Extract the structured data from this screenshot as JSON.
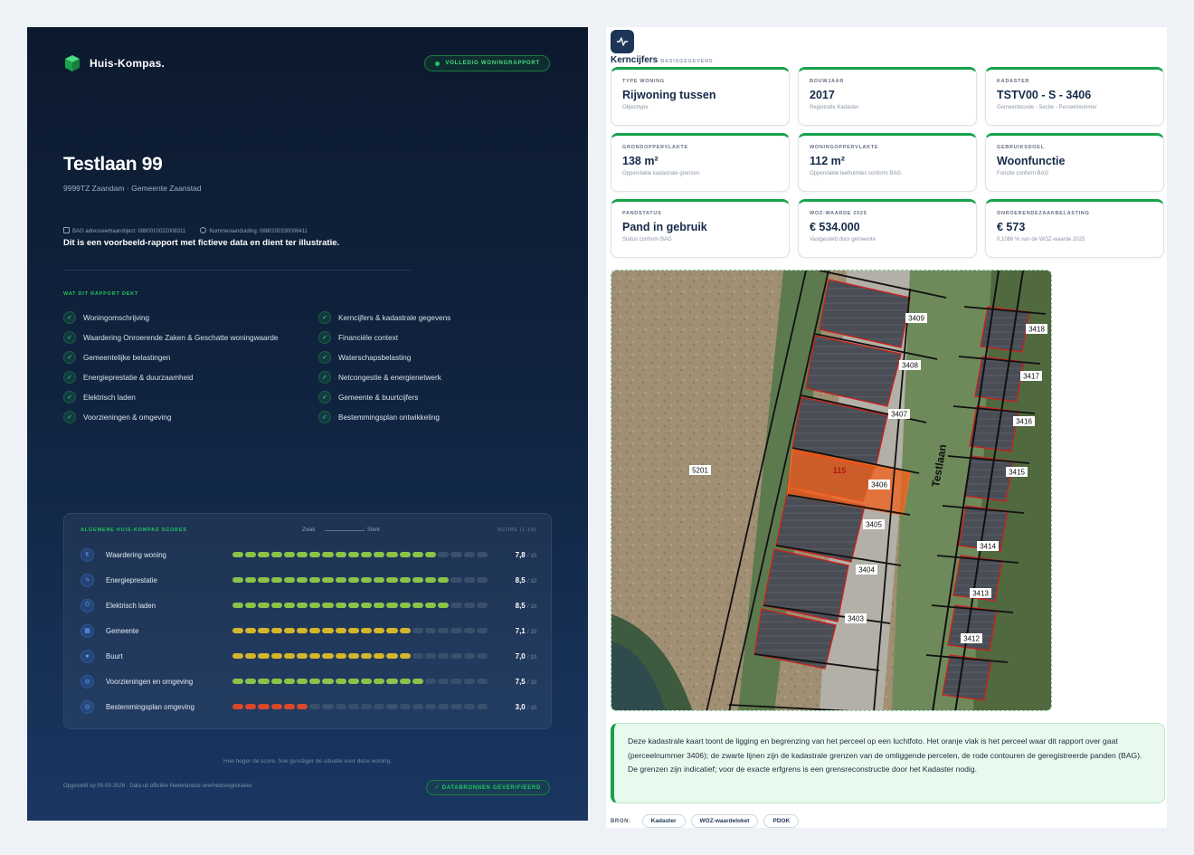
{
  "cover": {
    "brand": "Huis-Kompas.",
    "badge": "VOLLEDIG WONINGRAPPORT",
    "address": "Testlaan 99",
    "location": "9999TZ Zaandam · Gemeente Zaanstad",
    "bag_id": "BAG adresseerbaarobject: 0880010022008311",
    "num_id": "Nummeraanduiding: 0880200330006411",
    "disclaimer": "Dit is een voorbeeld-rapport met fictieve data en dient ter illustratie.",
    "covers_title": "WAT DIT RAPPORT DEKT",
    "covers_left": [
      "Woningomschrijving",
      "Waardering Onroerende Zaken & Geschatte woningwaarde",
      "Gemeentelijke belastingen",
      "Energieprestatie & duurzaamheid",
      "Elektrisch laden",
      "Voorzieningen & omgeving"
    ],
    "covers_right": [
      "Kerncijfers & kadastrale gegevens",
      "Financiële context",
      "Waterschapsbelasting",
      "Netcongestie & energienetwerk",
      "Gemeente & buurtcijfers",
      "Bestemmingsplan ontwikkeling"
    ],
    "scores_title": "ALGEMENE HUIS-KOMPAS SCORES",
    "weak": "Zwak",
    "strong": "Sterk",
    "score_label": "SCORE (1-10)",
    "out_of": "/ 10",
    "scores": [
      {
        "label": "Waardering woning",
        "value": "7,8",
        "score": 7.8,
        "color": "#8bc34a",
        "icon": "euro-icon"
      },
      {
        "label": "Energieprestatie",
        "value": "8,5",
        "score": 8.5,
        "color": "#8bc34a",
        "icon": "bolt-icon"
      },
      {
        "label": "Elektrisch laden",
        "value": "8,5",
        "score": 8.5,
        "color": "#8bc34a",
        "icon": "plug-icon"
      },
      {
        "label": "Gemeente",
        "value": "7,1",
        "score": 7.1,
        "color": "#d4b62c",
        "icon": "building-icon"
      },
      {
        "label": "Buurt",
        "value": "7,0",
        "score": 7.0,
        "color": "#d4b62c",
        "icon": "pin-icon"
      },
      {
        "label": "Voorzieningen en omgeving",
        "value": "7,5",
        "score": 7.5,
        "color": "#8bc34a",
        "icon": "compass-icon"
      },
      {
        "label": "Bestemmingsplan omgeving",
        "value": "3,0",
        "score": 3.0,
        "color": "#d9482b",
        "icon": "compass-icon"
      }
    ],
    "hint": "Hoe hoger de score, hoe gunstiger de situatie voor deze woning.",
    "footer": "Opgesteld op 05-05-2026 · Data uit officiële Nederlandse overheidsregistraties",
    "footer_badge": "✓  DATABRONNEN GEVERIFIEERD"
  },
  "kern": {
    "title": "Kerncijfers",
    "subtitle": "BASISGEGEVENS",
    "cards": [
      {
        "label": "TYPE WONING",
        "value": "Rijwoning tussen",
        "sub": "Objecttype"
      },
      {
        "label": "BOUWJAAR",
        "value": "2017",
        "sub": "Registratie Kadaster"
      },
      {
        "label": "KADASTER",
        "value": "TSTV00 - S - 3406",
        "sub": "Gemeentecode - Sectie - Perceelnummer"
      },
      {
        "label": "GRONDOPPERVLAKTE",
        "value": "138 m²",
        "sub": "Oppervlakte kadastrale grenzen"
      },
      {
        "label": "WONINGOPPERVLAKTE",
        "value": "112 m²",
        "sub": "Oppervlakte leefruimtes conform BAG"
      },
      {
        "label": "GEBRUIKSDOEL",
        "value": "Woonfunctie",
        "sub": "Functie conform BAG"
      },
      {
        "label": "PANDSTATUS",
        "value": "Pand in gebruik",
        "sub": "Status conform BAG"
      },
      {
        "label": "WOZ-WAARDE 2025",
        "value": "€ 534.000",
        "sub": "Vastgesteld door gemeente"
      },
      {
        "label": "ONROERENDEZAAKBELASTING",
        "value": "€ 573",
        "sub": "0,1086 % van de WOZ-waarde 2025"
      }
    ],
    "map": {
      "street": "Testlaan",
      "highlight": "115",
      "parcels": [
        "3409",
        "3408",
        "3407",
        "3406",
        "3405",
        "3404",
        "3403",
        "5201",
        "3418",
        "3417",
        "3416",
        "3415",
        "3414",
        "3413",
        "3412"
      ]
    },
    "note": "Deze kadastrale kaart toont de ligging en begrenzing van het perceel op een luchtfoto. Het oranje vlak is het perceel waar dit rapport over gaat (perceelnummer 3406); de zwarte lijnen zijn de kadastrale grenzen van de omliggende percelen, de rode contouren de geregistreerde panden (BAG). De grenzen zijn indicatief; voor de exacte erfgrens is een grensreconstructie door het Kadaster nodig.",
    "source_label": "BRON:",
    "sources": [
      "Kadaster",
      "WOZ-waardeloket",
      "PDOK"
    ]
  }
}
